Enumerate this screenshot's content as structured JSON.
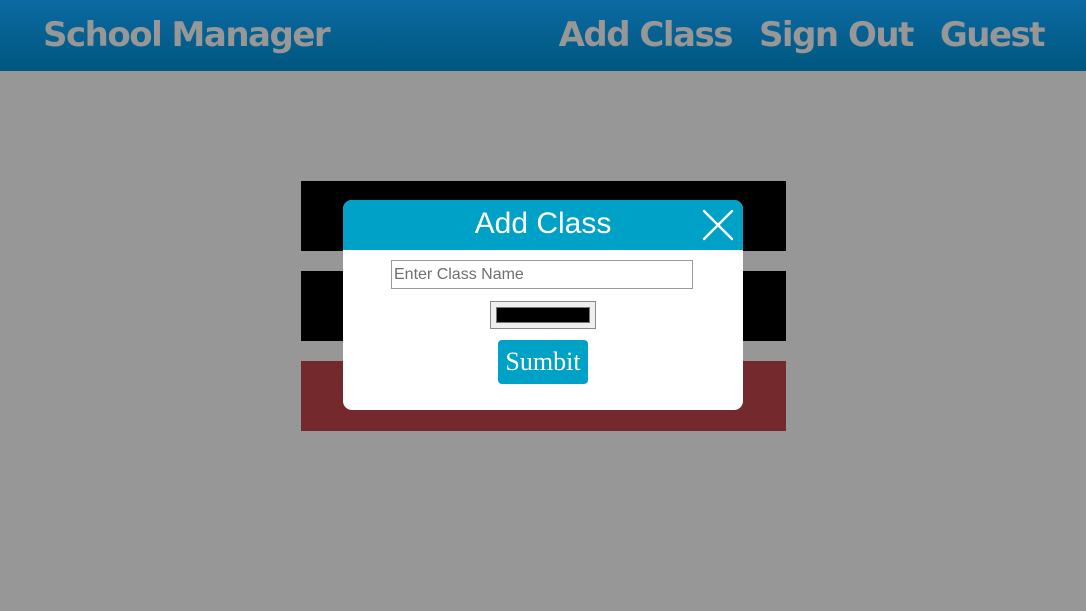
{
  "navbar": {
    "brand": "School Manager",
    "links": [
      {
        "label": "Add Class"
      },
      {
        "label": "Sign Out"
      },
      {
        "label": "Guest"
      }
    ]
  },
  "class_cards": [
    {
      "label": "",
      "color": "#000000"
    },
    {
      "label": "",
      "color": "#000000"
    },
    {
      "label": "",
      "color": "#74292d"
    }
  ],
  "modal": {
    "title": "Add Class",
    "close_icon": "close-icon",
    "class_name_input": {
      "value": "",
      "placeholder": "Enter Class Name"
    },
    "color_value": "#000000",
    "submit_label": "Sumbit"
  },
  "colors": {
    "navbar": "#00577f",
    "accent": "#00a1c6",
    "background": "#979797",
    "nav_text": "#979797"
  }
}
